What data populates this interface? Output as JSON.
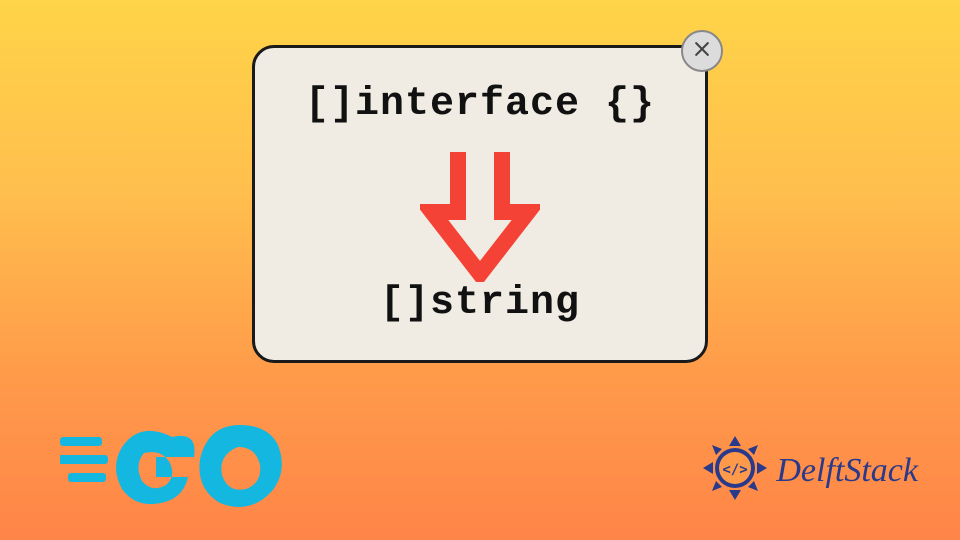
{
  "card": {
    "top_text": "[]interface {}",
    "bottom_text": "[]string"
  },
  "logos": {
    "go": "GO",
    "delft": "DelftStack"
  },
  "colors": {
    "arrow": "#f44336",
    "go_blue": "#14b7e0",
    "delft_blue": "#2a3a8a"
  }
}
